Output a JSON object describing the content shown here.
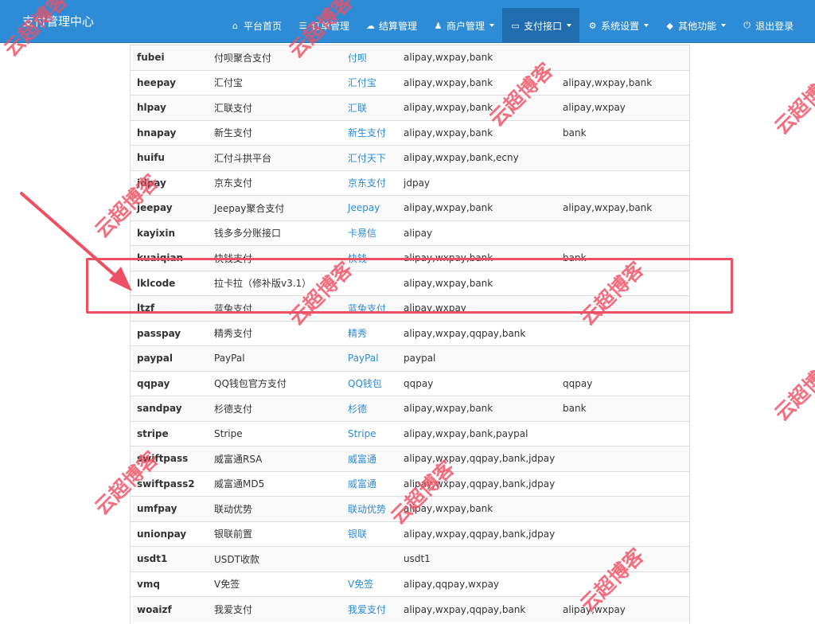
{
  "brand": "支付管理中心",
  "nav": [
    {
      "icon": "home-icon",
      "glyph": "⌂",
      "label": "平台首页",
      "dropdown": false,
      "active": false
    },
    {
      "icon": "list-icon",
      "glyph": "☰",
      "label": "订单管理",
      "dropdown": false,
      "active": false
    },
    {
      "icon": "cloud-icon",
      "glyph": "☁",
      "label": "结算管理",
      "dropdown": false,
      "active": false
    },
    {
      "icon": "user-icon",
      "glyph": "♟",
      "label": "商户管理",
      "dropdown": true,
      "active": false
    },
    {
      "icon": "card-icon",
      "glyph": "▭",
      "label": "支付接口",
      "dropdown": true,
      "active": true
    },
    {
      "icon": "gear-icon",
      "glyph": "⚙",
      "label": "系统设置",
      "dropdown": true,
      "active": false
    },
    {
      "icon": "cube-icon",
      "glyph": "◆",
      "label": "其他功能",
      "dropdown": true,
      "active": false
    },
    {
      "icon": "power-icon",
      "glyph": "⏻",
      "label": "退出登录",
      "dropdown": false,
      "active": false
    }
  ],
  "rows": [
    {
      "code": "fubei",
      "name": "付呗聚合支付",
      "link": "付呗",
      "types": "alipay,wxpay,bank",
      "types2": ""
    },
    {
      "code": "heepay",
      "name": "汇付宝",
      "link": "汇付宝",
      "types": "alipay,wxpay,bank",
      "types2": "alipay,wxpay,bank"
    },
    {
      "code": "hlpay",
      "name": "汇联支付",
      "link": "汇联",
      "types": "alipay,wxpay,bank",
      "types2": "alipay,wxpay"
    },
    {
      "code": "hnapay",
      "name": "新生支付",
      "link": "新生支付",
      "types": "alipay,wxpay,bank",
      "types2": "bank"
    },
    {
      "code": "huifu",
      "name": "汇付斗拱平台",
      "link": "汇付天下",
      "types": "alipay,wxpay,bank,ecny",
      "types2": ""
    },
    {
      "code": "jdpay",
      "name": "京东支付",
      "link": "京东支付",
      "types": "jdpay",
      "types2": ""
    },
    {
      "code": "jeepay",
      "name": "Jeepay聚合支付",
      "link": "Jeepay",
      "types": "alipay,wxpay,bank",
      "types2": "alipay,wxpay,bank"
    },
    {
      "code": "kayixin",
      "name": "钱多多分账接口",
      "link": "卡易信",
      "types": "alipay",
      "types2": ""
    },
    {
      "code": "kuaiqian",
      "name": "快钱支付",
      "link": "快钱",
      "types": "alipay,wxpay,bank",
      "types2": "bank"
    },
    {
      "code": "lklcode",
      "name": "拉卡拉（修补版v3.1）",
      "link": "",
      "types": "alipay,wxpay,bank",
      "types2": ""
    },
    {
      "code": "ltzf",
      "name": "蓝兔支付",
      "link": "蓝兔支付",
      "types": "alipay,wxpay",
      "types2": ""
    },
    {
      "code": "passpay",
      "name": "精秀支付",
      "link": "精秀",
      "types": "alipay,wxpay,qqpay,bank",
      "types2": ""
    },
    {
      "code": "paypal",
      "name": "PayPal",
      "link": "PayPal",
      "types": "paypal",
      "types2": ""
    },
    {
      "code": "qqpay",
      "name": "QQ钱包官方支付",
      "link": "QQ钱包",
      "types": "qqpay",
      "types2": "qqpay"
    },
    {
      "code": "sandpay",
      "name": "杉德支付",
      "link": "杉德",
      "types": "alipay,wxpay,bank",
      "types2": "bank"
    },
    {
      "code": "stripe",
      "name": "Stripe",
      "link": "Stripe",
      "types": "alipay,wxpay,bank,paypal",
      "types2": ""
    },
    {
      "code": "swiftpass",
      "name": "威富通RSA",
      "link": "威富通",
      "types": "alipay,wxpay,qqpay,bank,jdpay",
      "types2": ""
    },
    {
      "code": "swiftpass2",
      "name": "威富通MD5",
      "link": "威富通",
      "types": "alipay,wxpay,qqpay,bank,jdpay",
      "types2": ""
    },
    {
      "code": "umfpay",
      "name": "联动优势",
      "link": "联动优势",
      "types": "alipay,wxpay,bank",
      "types2": ""
    },
    {
      "code": "unionpay",
      "name": "银联前置",
      "link": "银联",
      "types": "alipay,wxpay,qqpay,bank,jdpay",
      "types2": ""
    },
    {
      "code": "usdt1",
      "name": "USDT收款",
      "link": "",
      "types": "usdt1",
      "types2": ""
    },
    {
      "code": "vmq",
      "name": "V免签",
      "link": "V免签",
      "types": "alipay,qqpay,wxpay",
      "types2": ""
    },
    {
      "code": "woaizf",
      "name": "我爱支付",
      "link": "我爱支付",
      "types": "alipay,wxpay,qqpay,bank",
      "types2": "alipay,wxpay"
    }
  ],
  "watermark": "云超博客",
  "annotation_color": "#ef4f63",
  "accent": "#2e8bd6"
}
